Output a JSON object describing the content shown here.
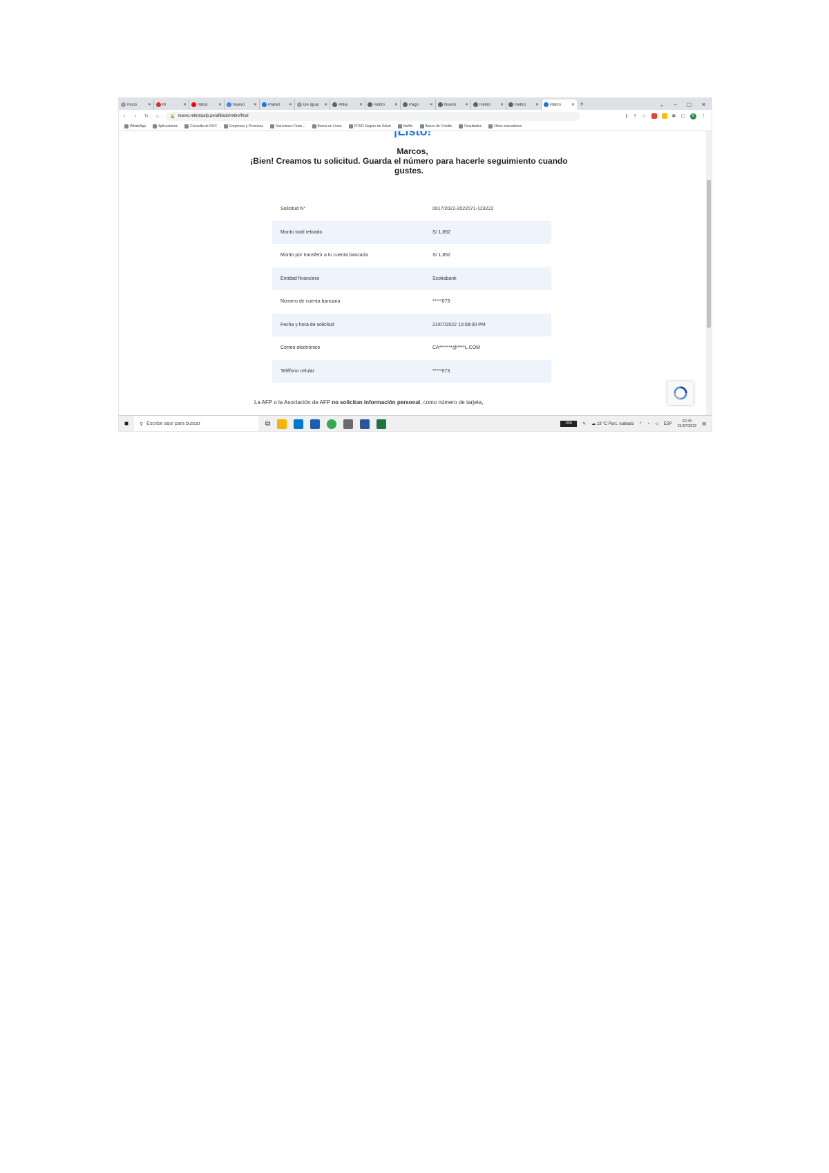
{
  "tabs": [
    {
      "title": "Inicio",
      "favicon_color": "#9aa0a6"
    },
    {
      "title": "M",
      "favicon_color": "#d93025"
    },
    {
      "title": "Inbox",
      "favicon_color": "#ff0000"
    },
    {
      "title": "Nuevo",
      "favicon_color": "#4285f4"
    },
    {
      "title": "Planet",
      "favicon_color": "#1a73e8"
    },
    {
      "title": "De Igual",
      "favicon_color": "#9aa0a6"
    },
    {
      "title": "Afilia",
      "favicon_color": "#5f6368"
    },
    {
      "title": "Retiro",
      "favicon_color": "#5f6368"
    },
    {
      "title": "Pago",
      "favicon_color": "#5f6368"
    },
    {
      "title": "Nuevo",
      "favicon_color": "#5f6368"
    },
    {
      "title": "Retiro",
      "favicon_color": "#5f6368"
    },
    {
      "title": "Retiro",
      "favicon_color": "#5f6368"
    },
    {
      "title": "Retiro",
      "favicon_color": "#1a73e8",
      "active": true
    }
  ],
  "address": {
    "url": "nuevo.retirotuafp.pe/afiliado/retiro/final"
  },
  "bookmarks": [
    "WhatsApp",
    "Aplicaciones",
    "Consulta de RUC",
    "Empresas y Personas",
    "Soluciones Finan...",
    "Banca en Línea",
    "PCSFi Seguro de Salud",
    "Netflix",
    "Banco de Crédito",
    "Resultados",
    "Otros marcadores"
  ],
  "page": {
    "heading": "¡Listo!",
    "greeting": "Marcos,",
    "message": "¡Bien! Creamos tu solicitud. Guarda el número para hacerle seguimiento cuando gustes.",
    "details": [
      {
        "label": "Solicitud N°",
        "value": "0017/2022-2022071-123222"
      },
      {
        "label": "Monto total retirado",
        "value": "S/ 1,852"
      },
      {
        "label": "Monto por transferir a tu cuenta bancaria",
        "value": "S/ 1,852"
      },
      {
        "label": "Entidad financiera",
        "value": "Scotiabank"
      },
      {
        "label": "Número de cuenta bancaria",
        "value": "*****073"
      },
      {
        "label": "Fecha y hora de solicitud",
        "value": "21/07/2022 10:08:00 PM"
      },
      {
        "label": "Correo electrónico",
        "value": "CA*******@****L.COM"
      },
      {
        "label": "Teléfono celular",
        "value": "*****073"
      }
    ],
    "notice_prefix": "La AFP o la Asociación de AFP ",
    "notice_bold": "no solicitan información personal",
    "notice_suffix": ", como número de tarjeta,"
  },
  "taskbar": {
    "search_placeholder": "Escribe aquí para buscar",
    "battery": "19%",
    "weather": "18 °C Parc. nublado",
    "language": "ESP",
    "time": "22:40",
    "date": "21/07/2022"
  }
}
